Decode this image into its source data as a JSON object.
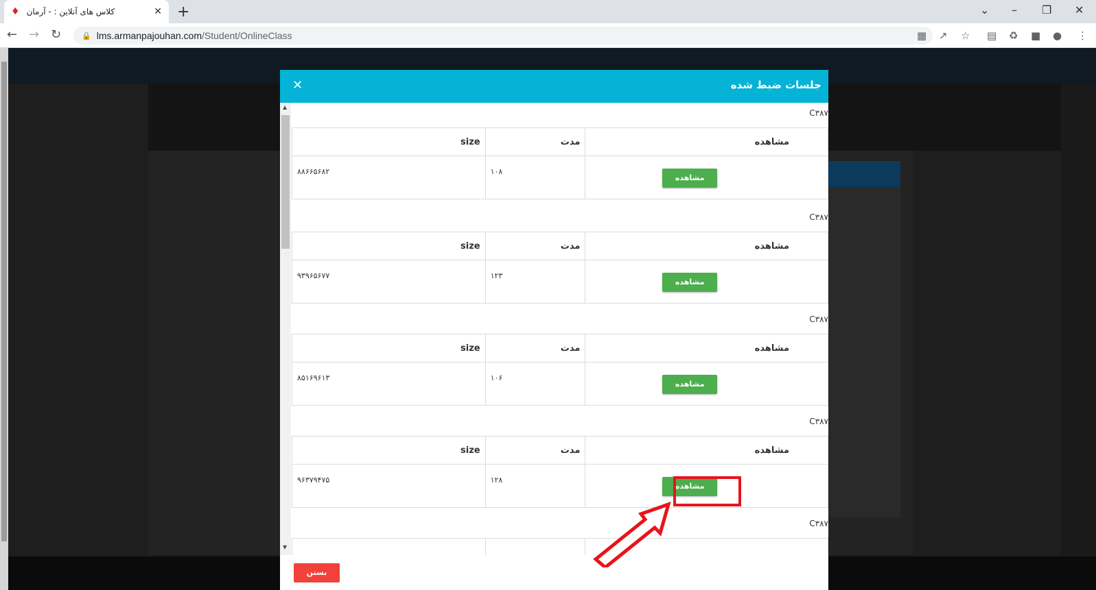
{
  "browser": {
    "tab_title": "کلاس های آنلاین : - آرمان",
    "url_host": "lms.armanpajouhan.com",
    "url_path": "/Student/OnlineClass"
  },
  "modal": {
    "title": "جلسات ضبط شده",
    "close_label": "بستن",
    "columns": {
      "view": "مشاهده",
      "duration": "مدت",
      "size": "size"
    },
    "view_button_label": "مشاهده",
    "sessions": [
      {
        "label": "C۳۸۷",
        "duration": "۱۰۸",
        "size": "۸۸۶۶۵۶۸۲"
      },
      {
        "label": "C۳۸۷",
        "duration": "۱۲۳",
        "size": "۹۳۹۶۵۶۷۷"
      },
      {
        "label": "C۳۸۷",
        "duration": "۱۰۶",
        "size": "۸۵۱۶۹۶۱۳"
      },
      {
        "label": "C۳۸۷",
        "duration": "۱۲۸",
        "size": "۹۶۳۷۹۴۷۵"
      },
      {
        "label": "C۳۸۷",
        "duration": "",
        "size": ""
      }
    ]
  },
  "annotation": {
    "highlight_color": "#e8141b",
    "highlighted_session": 4
  },
  "colors": {
    "header": "#05b3d6",
    "view_button": "#4cae4c",
    "close_button": "#f0413a"
  }
}
